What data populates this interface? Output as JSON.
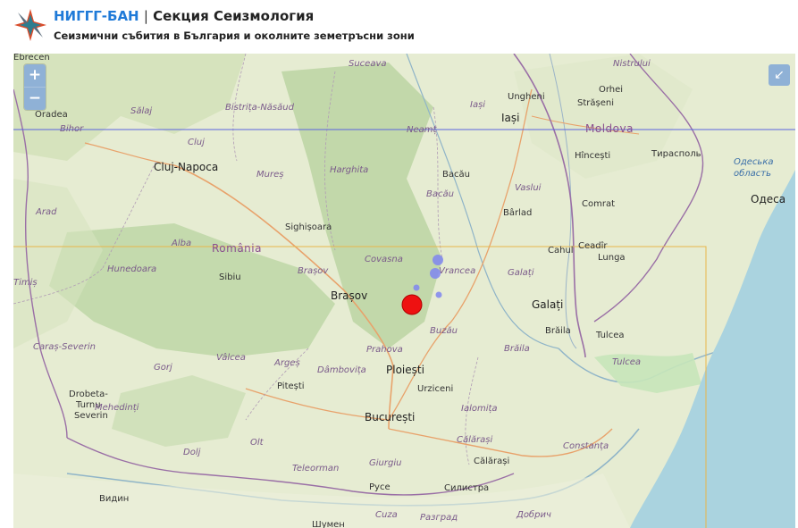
{
  "header": {
    "org": "НИГГГ-БАН",
    "separator": "|",
    "section": "Секция Сеизмология",
    "subtitle": "Сеизмични събития в България и околните земетръсни зони"
  },
  "controls": {
    "zoom_in": "+",
    "zoom_out": "−",
    "fullscreen_icon": "↙"
  },
  "map": {
    "country_labels": [
      "România",
      "Moldova"
    ],
    "cities": [
      {
        "name": "Cluj-Napoca",
        "big": true
      },
      {
        "name": "Brașov",
        "big": true
      },
      {
        "name": "Ploiești",
        "big": true
      },
      {
        "name": "București",
        "big": true
      },
      {
        "name": "Galați",
        "big": true
      },
      {
        "name": "Iași",
        "big": true
      },
      {
        "name": "Одеса",
        "big": true
      },
      {
        "name": "Oradea",
        "big": false
      },
      {
        "name": "Sibiu",
        "big": false
      },
      {
        "name": "Sighișoara",
        "big": false
      },
      {
        "name": "Bacău",
        "big": false
      },
      {
        "name": "Bârlad",
        "big": false
      },
      {
        "name": "Brăila",
        "big": false
      },
      {
        "name": "Tulcea",
        "big": false
      },
      {
        "name": "Cahul",
        "big": false
      },
      {
        "name": "Lunga",
        "big": false
      },
      {
        "name": "Comrat",
        "big": false
      },
      {
        "name": "Hîncești",
        "big": false
      },
      {
        "name": "Тирасполь",
        "big": false
      },
      {
        "name": "Ungheni",
        "big": false
      },
      {
        "name": "Orhei",
        "big": false
      },
      {
        "name": "Strășeni",
        "big": false
      },
      {
        "name": "Pitești",
        "big": false
      },
      {
        "name": "Urziceni",
        "big": false
      },
      {
        "name": "Călărași",
        "big": false
      },
      {
        "name": "Русе",
        "big": false
      },
      {
        "name": "Видин",
        "big": false
      },
      {
        "name": "Severin",
        "big": false
      },
      {
        "name": "Drobeta-",
        "big": false
      },
      {
        "name": "Turnu",
        "big": false
      },
      {
        "name": "Ceadîr",
        "big": false
      },
      {
        "name": "Силистра",
        "big": false
      },
      {
        "name": "Шумен",
        "big": false
      },
      {
        "name": "Ebrecen",
        "big": false
      }
    ],
    "regions": [
      "Suceava",
      "Bistrița-Năsăud",
      "Sălaj",
      "Bihor",
      "Cluj",
      "Neamț",
      "Iași",
      "Harghita",
      "Mureș",
      "Bacău",
      "Vaslui",
      "Alba",
      "Arad",
      "Hunedoara",
      "Timiș",
      "Caraș-Severin",
      "Gorj",
      "Vâlcea",
      "Argeș",
      "Dâmbovița",
      "Prahova",
      "Buzău",
      "Brăila",
      "Galați",
      "Vrancea",
      "Covasna",
      "Brașov",
      "Mehedinți",
      "Dolj",
      "Olt",
      "Teleorman",
      "Giurgiu",
      "Ialomița",
      "Constanța",
      "Tulcea",
      "Călărași",
      "Разград",
      "Добрич",
      "Nistrului",
      "Cuza"
    ],
    "sea_labels": [
      "Одеська",
      "область"
    ],
    "events": [
      {
        "label": "large-event",
        "magnitude_class": "large"
      },
      {
        "label": "small-event",
        "magnitude_class": "small"
      },
      {
        "label": "small-event",
        "magnitude_class": "small"
      },
      {
        "label": "small-event",
        "magnitude_class": "small"
      },
      {
        "label": "small-event",
        "magnitude_class": "small"
      }
    ],
    "colors": {
      "event_large": "#ee1111",
      "event_small": "#7f86f0",
      "study_area_border": "#e8b64a",
      "latitude_line": "#5a63e0",
      "sea": "#aad3df",
      "land": "#e5ecd4"
    }
  }
}
